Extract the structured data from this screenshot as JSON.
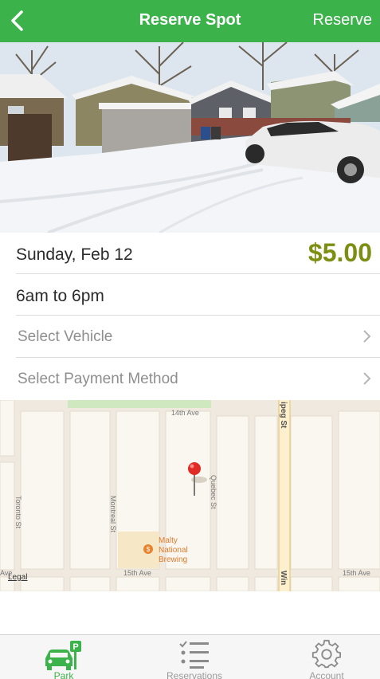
{
  "navbar": {
    "title": "Reserve Spot",
    "action_label": "Reserve",
    "back_icon": "chevron-left-icon",
    "color": "#3cb24b"
  },
  "spot": {
    "date": "Sunday, Feb 12",
    "price": "$5.00",
    "time_range": "6am to 6pm",
    "price_color": "#7d8f12"
  },
  "options": {
    "vehicle_label": "Select Vehicle",
    "payment_label": "Select Payment Method"
  },
  "map": {
    "streets": {
      "top_ave": "14th Ave",
      "bottom_ave": "15th Ave",
      "bottom_ave_left": "Ave",
      "toronto": "Toronto St",
      "montreal": "Montreal St",
      "quebec": "Quebec St",
      "winnipeg_top": "ipeg St",
      "winnipeg_bottom": "Win"
    },
    "poi_name": "Malty National Brewing",
    "legal_label": "Legal"
  },
  "tabs": [
    {
      "label": "Park",
      "icon": "car-parking-icon",
      "active": true
    },
    {
      "label": "Reservations",
      "icon": "list-icon",
      "active": false
    },
    {
      "label": "Account",
      "icon": "gear-icon",
      "active": false
    }
  ]
}
